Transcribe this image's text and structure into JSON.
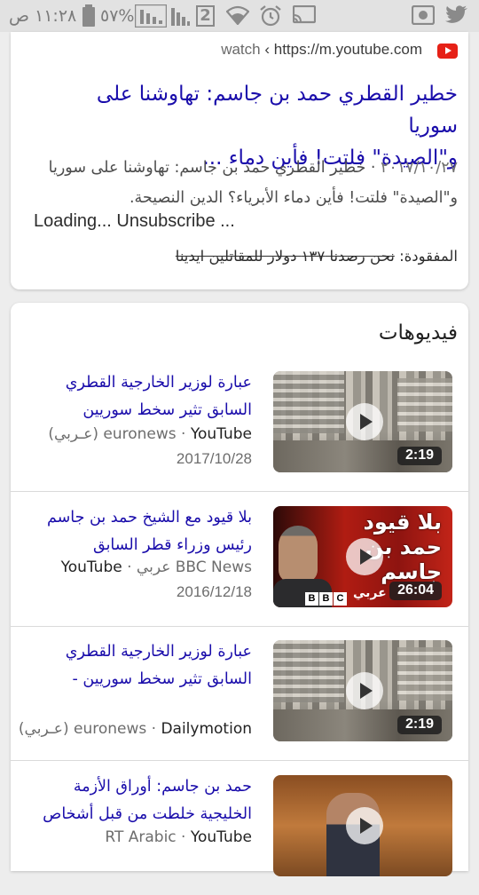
{
  "status_bar": {
    "time": "١١:٢٨ ص",
    "battery_percent": "٥٧%",
    "sim_number": "2",
    "icons": [
      "battery-icon",
      "signal-icon",
      "signal-icon",
      "sim-icon",
      "wifi-icon",
      "alarm-icon",
      "cast-icon",
      "screen-record-icon",
      "twitter-icon"
    ]
  },
  "result_card": {
    "source_label": "watch",
    "source_sep": "‹",
    "source_url": "https://m.youtube.com",
    "title_line1": "خطير القطري حمد بن جاسم: تهاوشنا على سوريا",
    "title_line2": "و\"الصيدة\" فلتت! فأين دماء ...",
    "snippet_date": "٢٠١٧/١٠/٢٧",
    "snippet_text_line1": "· خطير القطري حمد بن جاسم: تهاوشنا على سوريا",
    "snippet_text_line2": "و\"الصيدة\" فلتت! فأين دماء الأبرياء؟ الدين النصيحة.",
    "loading_text": "Loading... Unsubscribe ...",
    "missing_label": "المفقودة:",
    "missing_text": "نحن رصدنا ١٣٧ دولار للمقاتلين ايدينا"
  },
  "videos": {
    "heading": "فيديوهات",
    "items": [
      {
        "title_line1": "عبارة لوزير الخارجية القطري",
        "title_line2": "السابق تثير سخط سوريين",
        "platform": "YouTube",
        "channel": "euronews",
        "language": "(عـربي)",
        "date": "2017/10/28",
        "duration": "2:19"
      },
      {
        "title_line1": "بلا قيود مع الشيخ حمد بن جاسم",
        "title_line2": "رئيس وزراء قطر السابق",
        "platform": "YouTube",
        "channel": "BBC News عربي",
        "language": "",
        "date": "2016/12/18",
        "duration": "26:04",
        "thumb_text_line1": "بلا قيود",
        "thumb_text_line2": "حمد بن",
        "thumb_text_line3": "جاسم",
        "thumb_logo_letters": [
          "B",
          "B",
          "C"
        ],
        "thumb_logo_ar": "عربي"
      },
      {
        "title_line1": "عبارة لوزير الخارجية القطري",
        "title_line2": "السابق تثير سخط سوريين -",
        "platform": "Dailymotion",
        "channel": "euronews",
        "language": "(عـربي)",
        "date": "",
        "duration": "2:19"
      },
      {
        "title_line1": "حمد بن جاسم: أوراق الأزمة",
        "title_line2": "الخليجية خلطت من قبل أشخاص",
        "platform": "YouTube",
        "channel": "RT Arabic",
        "language": "",
        "date": "",
        "duration": ""
      }
    ]
  },
  "colors": {
    "link": "#1a0dab",
    "youtube_red": "#e62117",
    "status_bar_bg": "#e2e2e2",
    "page_bg": "#ededed"
  }
}
